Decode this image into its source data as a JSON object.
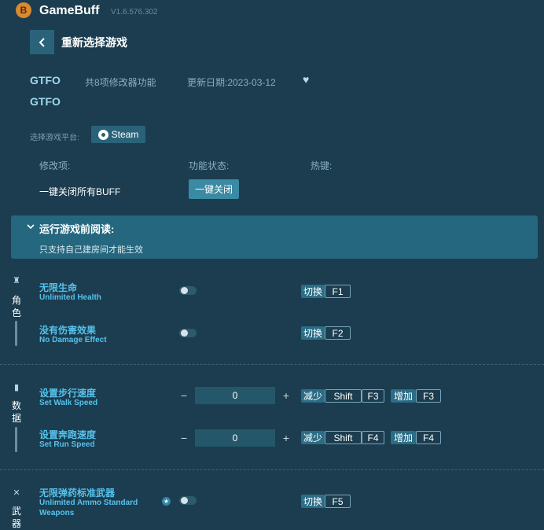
{
  "app": {
    "name": "GameBuff",
    "version": "V1.6.576.302",
    "logo_glyph": "B"
  },
  "header": {
    "back_icon": "chevron-left-icon",
    "title": "重新选择游戏"
  },
  "game": {
    "name": "GTFO",
    "name2": "GTFO",
    "feature_count": "共8项修改器功能",
    "update_date": "更新日期:2023-03-12",
    "favorite_icon": "heart-icon"
  },
  "platform": {
    "label": "选择游戏平台:",
    "button": "Steam"
  },
  "columns": {
    "mod": "修改项:",
    "status": "功能状态:",
    "hotkey": "热键:"
  },
  "global": {
    "label": "一键关闭所有BUFF",
    "button": "一键关闭"
  },
  "notice": {
    "title": "运行游戏前阅读:",
    "body": "只支持自己建房间才能生效"
  },
  "categories": {
    "character": {
      "c1": "角",
      "c2": "色"
    },
    "data": {
      "c1": "数",
      "c2": "据"
    },
    "weapon": {
      "c1": "武",
      "c2": "器"
    }
  },
  "features": {
    "f1": {
      "cn": "无限生命",
      "en": "Unlimited Health",
      "toggle": false,
      "action": "切换",
      "key": "F1"
    },
    "f2": {
      "cn": "没有伤害效果",
      "en": "No Damage Effect",
      "toggle": false,
      "action": "切换",
      "key": "F2"
    },
    "f3": {
      "cn": "设置步行速度",
      "en": "Set Walk Speed",
      "value": "0",
      "dec": "减少",
      "dec_mod": "Shift",
      "dec_key": "F3",
      "inc": "增加",
      "inc_key": "F3"
    },
    "f4": {
      "cn": "设置奔跑速度",
      "en": "Set Run Speed",
      "value": "0",
      "dec": "减少",
      "dec_mod": "Shift",
      "dec_key": "F4",
      "inc": "增加",
      "inc_key": "F4"
    },
    "f5": {
      "cn": "无限弹药标准武器",
      "en1": "Unlimited Ammo Standard",
      "en2": "Weapons",
      "toggle": false,
      "action": "切换",
      "key": "F5"
    }
  },
  "colors": {
    "background": "#1b3d4f",
    "accent": "#56c2ec",
    "button": "#2a6379"
  }
}
